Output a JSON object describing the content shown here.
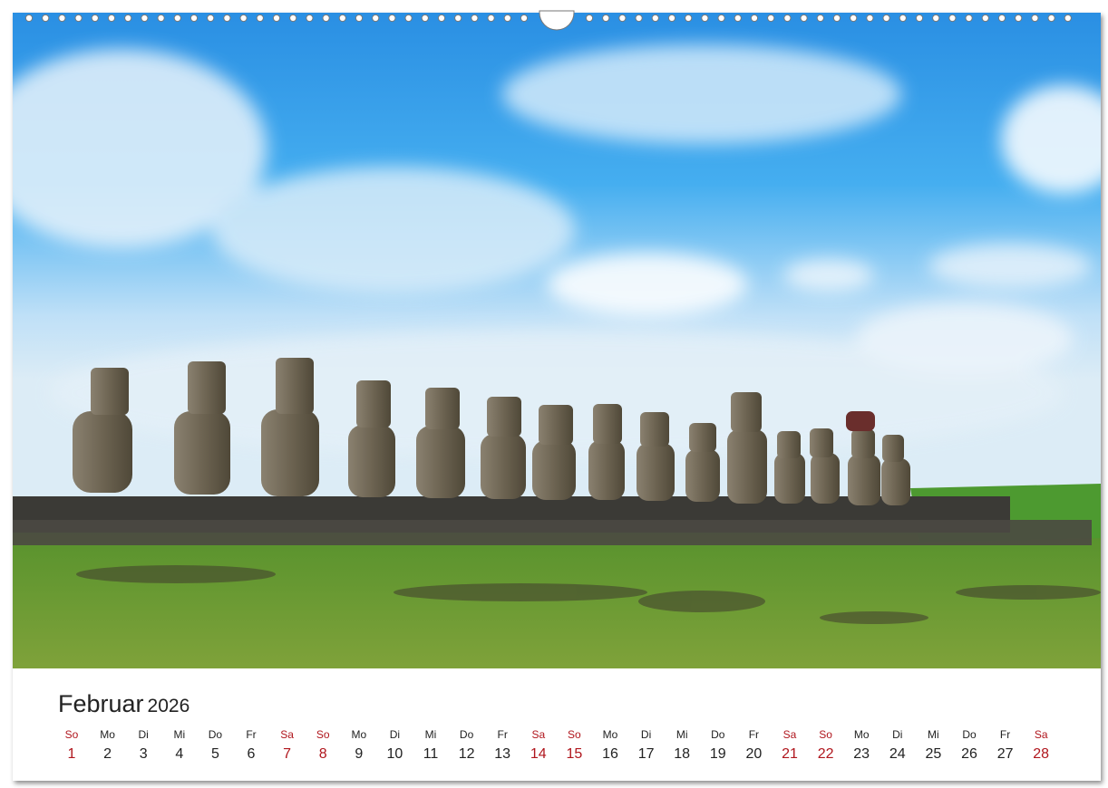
{
  "calendar": {
    "month": "Februar",
    "year": "2026",
    "weekend_color": "#b0161d",
    "days": [
      {
        "wd": "So",
        "num": "1",
        "weekend": true
      },
      {
        "wd": "Mo",
        "num": "2",
        "weekend": false
      },
      {
        "wd": "Di",
        "num": "3",
        "weekend": false
      },
      {
        "wd": "Mi",
        "num": "4",
        "weekend": false
      },
      {
        "wd": "Do",
        "num": "5",
        "weekend": false
      },
      {
        "wd": "Fr",
        "num": "6",
        "weekend": false
      },
      {
        "wd": "Sa",
        "num": "7",
        "weekend": true
      },
      {
        "wd": "So",
        "num": "8",
        "weekend": true
      },
      {
        "wd": "Mo",
        "num": "9",
        "weekend": false
      },
      {
        "wd": "Di",
        "num": "10",
        "weekend": false
      },
      {
        "wd": "Mi",
        "num": "11",
        "weekend": false
      },
      {
        "wd": "Do",
        "num": "12",
        "weekend": false
      },
      {
        "wd": "Fr",
        "num": "13",
        "weekend": false
      },
      {
        "wd": "Sa",
        "num": "14",
        "weekend": true
      },
      {
        "wd": "So",
        "num": "15",
        "weekend": true
      },
      {
        "wd": "Mo",
        "num": "16",
        "weekend": false
      },
      {
        "wd": "Di",
        "num": "17",
        "weekend": false
      },
      {
        "wd": "Mi",
        "num": "18",
        "weekend": false
      },
      {
        "wd": "Do",
        "num": "19",
        "weekend": false
      },
      {
        "wd": "Fr",
        "num": "20",
        "weekend": false
      },
      {
        "wd": "Sa",
        "num": "21",
        "weekend": true
      },
      {
        "wd": "So",
        "num": "22",
        "weekend": true
      },
      {
        "wd": "Mo",
        "num": "23",
        "weekend": false
      },
      {
        "wd": "Di",
        "num": "24",
        "weekend": false
      },
      {
        "wd": "Mi",
        "num": "25",
        "weekend": false
      },
      {
        "wd": "Do",
        "num": "26",
        "weekend": false
      },
      {
        "wd": "Fr",
        "num": "27",
        "weekend": false
      },
      {
        "wd": "Sa",
        "num": "28",
        "weekend": true
      }
    ]
  },
  "photo": {
    "sky_color": "#2f9ae6",
    "grass_color": "#5a9a2c",
    "moai_count": 15
  }
}
